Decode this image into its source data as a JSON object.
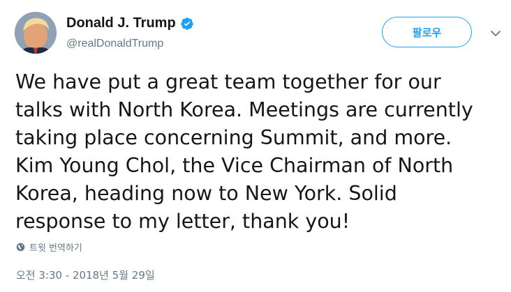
{
  "author": {
    "display_name": "Donald J. Trump",
    "handle": "@realDonaldTrump",
    "verified": true
  },
  "follow_button_label": "팔로우",
  "tweet": {
    "text": "We have put a great team together for our\ntalks with North Korea. Meetings are currently\ntaking place concerning Summit, and more.\nKim Young Chol, the Vice Chairman of North\nKorea, heading now to New York. Solid\nresponse to my letter, thank you!"
  },
  "translate_label": "트윗 번역하기",
  "timestamp": "오전 3:30 - 2018년 5월 29일",
  "icons": {
    "verified": "verified-badge-icon",
    "menu": "chevron-down-icon",
    "translate": "globe-icon"
  },
  "colors": {
    "accent": "#1da1f2",
    "text": "#14171a",
    "muted": "#657786"
  }
}
